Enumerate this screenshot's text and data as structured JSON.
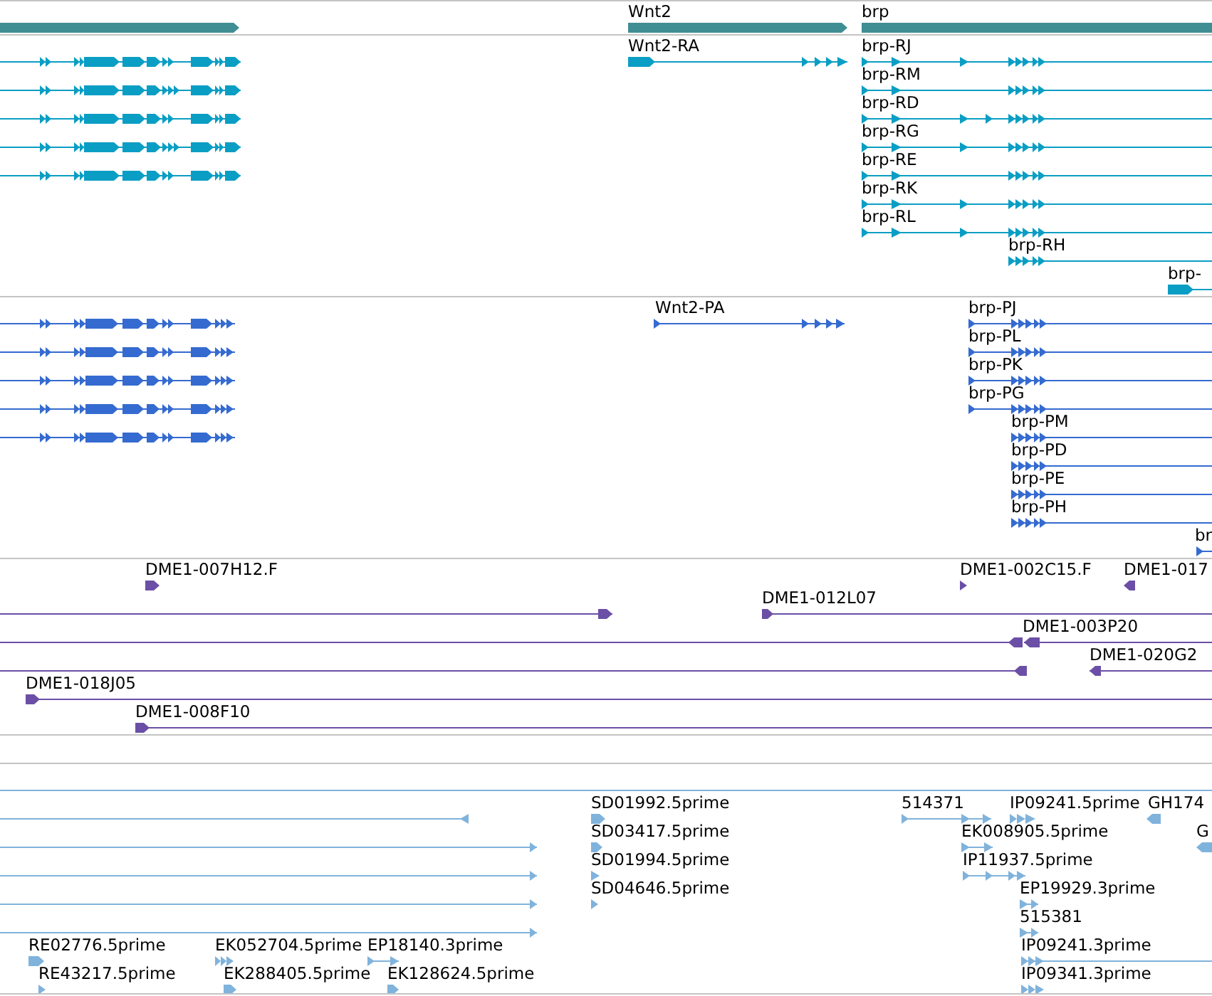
{
  "tracks": [
    {
      "kind": "gene",
      "features": [
        {
          "reverse": false
        },
        {
          "label": "Wnt2",
          "reverse": false
        },
        {
          "label": "brp",
          "reverse": false
        }
      ]
    },
    {
      "kind": "mrna",
      "features": [
        {
          "reverse": false
        },
        {
          "label": "Wnt2-RA",
          "reverse": false
        },
        {
          "label": "brp-RJ",
          "reverse": false
        },
        {
          "reverse": false
        },
        {
          "label": "brp-RM",
          "reverse": false
        },
        {
          "reverse": false
        },
        {
          "label": "brp-RD",
          "reverse": false
        },
        {
          "reverse": false
        },
        {
          "label": "brp-RG",
          "reverse": false
        },
        {
          "reverse": false
        },
        {
          "label": "brp-RE",
          "reverse": false
        },
        {
          "label": "brp-RK",
          "reverse": false
        },
        {
          "label": "brp-RL",
          "reverse": false
        },
        {
          "label": "brp-RH",
          "reverse": false
        },
        {
          "label": "brp-",
          "reverse": false
        }
      ]
    },
    {
      "kind": "protein",
      "features": [
        {
          "reverse": false
        },
        {
          "label": "Wnt2-PA",
          "reverse": false
        },
        {
          "label": "brp-PJ",
          "reverse": false
        },
        {
          "reverse": false
        },
        {
          "label": "brp-PL",
          "reverse": false
        },
        {
          "reverse": false
        },
        {
          "label": "brp-PK",
          "reverse": false
        },
        {
          "reverse": false
        },
        {
          "label": "brp-PG",
          "reverse": false
        },
        {
          "reverse": false
        },
        {
          "label": "brp-PM",
          "reverse": false
        },
        {
          "label": "brp-PD",
          "reverse": false
        },
        {
          "label": "brp-PE",
          "reverse": false
        },
        {
          "label": "brp-PH",
          "reverse": false
        },
        {
          "label": "br",
          "reverse": false
        }
      ]
    },
    {
      "kind": "clone",
      "features": [
        {
          "label": "DME1-007H12.F",
          "reverse": false
        },
        {
          "label": "DME1-002C15.F",
          "reverse": false
        },
        {
          "label": "DME1-017",
          "reverse": true
        },
        {
          "reverse": false
        },
        {
          "label": "DME1-012L07",
          "reverse": false
        },
        {
          "reverse": true
        },
        {
          "label": "DME1-003P20",
          "reverse": true
        },
        {
          "reverse": true
        },
        {
          "label": "DME1-020G2",
          "reverse": true
        },
        {
          "label": "DME1-018J05",
          "reverse": false
        },
        {
          "label": "DME1-008F10",
          "reverse": false
        }
      ]
    },
    {
      "kind": "empty"
    },
    {
      "kind": "est",
      "spanning_alignment": true,
      "features": [
        {
          "reverse": true
        },
        {
          "label": "SD01992.5prime",
          "reverse": false
        },
        {
          "label": "514371",
          "reverse": false
        },
        {
          "label": "IP09241.5prime",
          "reverse": false
        },
        {
          "label": "GH174",
          "reverse": true
        },
        {
          "reverse": false
        },
        {
          "label": "SD03417.5prime",
          "reverse": false
        },
        {
          "label": "EK008905.5prime",
          "reverse": false
        },
        {
          "label": "G",
          "reverse": true
        },
        {
          "reverse": false
        },
        {
          "label": "SD01994.5prime",
          "reverse": false
        },
        {
          "label": "IP11937.5prime",
          "reverse": false
        },
        {
          "reverse": false
        },
        {
          "label": "SD04646.5prime",
          "reverse": false
        },
        {
          "label": "EP19929.3prime",
          "reverse": false
        },
        {
          "reverse": false
        },
        {
          "label": "515381",
          "reverse": false
        },
        {
          "label": "RE02776.5prime",
          "reverse": false
        },
        {
          "label": "EK052704.5prime",
          "reverse": false
        },
        {
          "label": "EP18140.3prime",
          "reverse": false
        },
        {
          "label": "IP09241.3prime",
          "reverse": false
        },
        {
          "label": "RE43217.5prime",
          "reverse": false
        },
        {
          "label": "EK288405.5prime",
          "reverse": false
        },
        {
          "label": "EK128624.5prime",
          "reverse": false
        },
        {
          "label": "IP09341.3prime",
          "reverse": false
        }
      ]
    }
  ]
}
